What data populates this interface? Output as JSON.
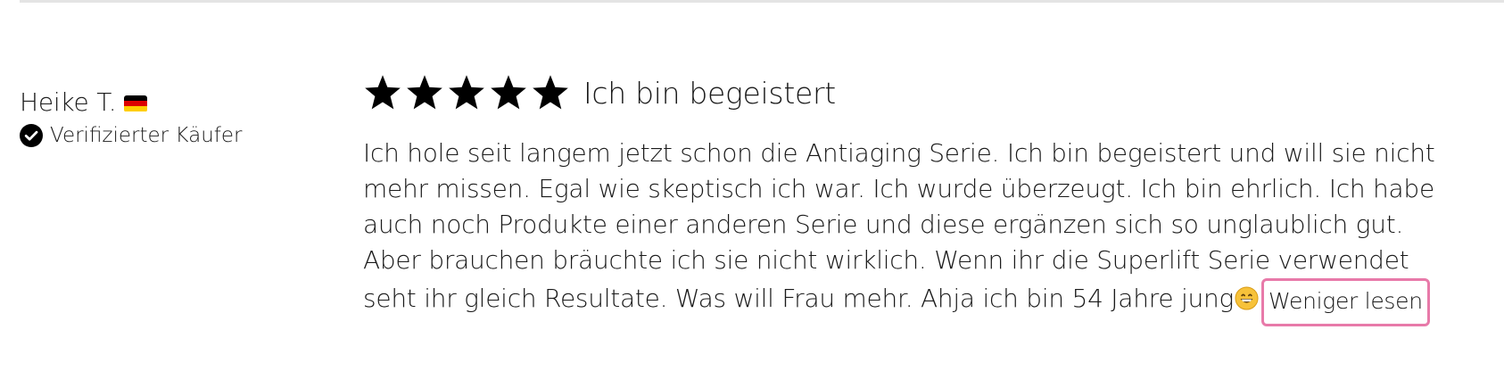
{
  "reviewer": {
    "name": "Heike T.",
    "country_flag_icon": "germany-flag-icon",
    "verified_icon": "check-circle-icon",
    "verified_label": "Verifizierter Käufer"
  },
  "review": {
    "rating": 5,
    "rating_max": 5,
    "title": "Ich bin begeistert",
    "body": "Ich hole seit langem jetzt schon die Antiaging Serie. Ich bin begeistert und will sie nicht mehr missen. Egal wie skeptisch ich war. Ich wurde überzeugt. Ich bin ehrlich. Ich habe auch noch Produkte einer anderen Serie und diese ergänzen sich so unglaublich gut. Aber brauchen bräuchte ich sie nicht wirklich. Wenn ihr die Superlift Serie verwendet seht ihr gleich Resultate. Was will Frau mehr. Ahja ich bin 54 Jahre jung",
    "trailing_emoji_icon": "grinning-face-emoji-icon",
    "read_less_label": "Weniger lesen"
  },
  "colors": {
    "text": "#1a1a1a",
    "divider": "#e4e4e4",
    "focus_outline": "#e87aa9",
    "flag_black": "#000000",
    "flag_red": "#dd0000",
    "flag_gold": "#ffce00"
  }
}
